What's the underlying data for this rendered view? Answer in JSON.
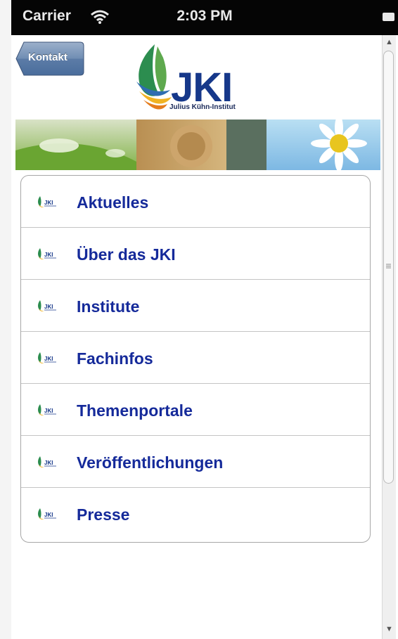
{
  "status_bar": {
    "carrier": "Carrier",
    "time": "2:03 PM"
  },
  "nav": {
    "back_label": "Kontakt"
  },
  "header": {
    "logo_text": "JKI",
    "logo_subtitle": "Julius Kühn-Institut"
  },
  "menu": {
    "items": [
      {
        "label": "Aktuelles"
      },
      {
        "label": "Über das JKI"
      },
      {
        "label": "Institute"
      },
      {
        "label": "Fachinfos"
      },
      {
        "label": "Themenportale"
      },
      {
        "label": "Veröffentlichungen"
      },
      {
        "label": "Presse"
      }
    ]
  },
  "colors": {
    "menu_text": "#152a9a",
    "logo_blue": "#16388a",
    "nav_button": "#5f7fa7"
  }
}
